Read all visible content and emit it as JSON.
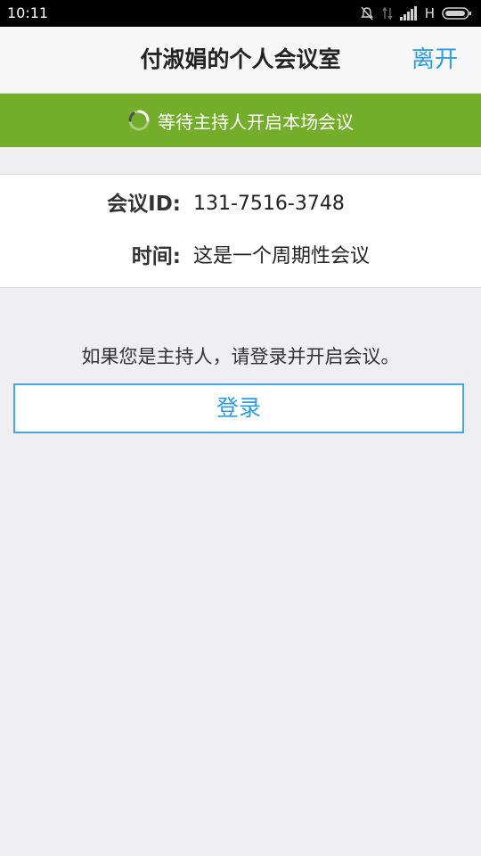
{
  "status_bar": {
    "time": "10:11",
    "network_type": "H",
    "icons": [
      "alarm-off-icon",
      "data-transfer-icon",
      "signal-icon",
      "battery-icon"
    ]
  },
  "header": {
    "title": "付淑娟的个人会议室",
    "leave_label": "离开"
  },
  "banner": {
    "text": "等待主持人开启本场会议",
    "icon": "loading-spinner-icon"
  },
  "meeting_info": {
    "id_label": "会议ID:",
    "id_value": "131-7516-3748",
    "time_label": "时间:",
    "time_value": "这是一个周期性会议"
  },
  "host_prompt": {
    "text": "如果您是主持人，请登录并开启会议。",
    "login_label": "登录"
  },
  "colors": {
    "accent_blue": "#2e9be6",
    "banner_green": "#73ad2a",
    "background": "#eeeef3"
  }
}
